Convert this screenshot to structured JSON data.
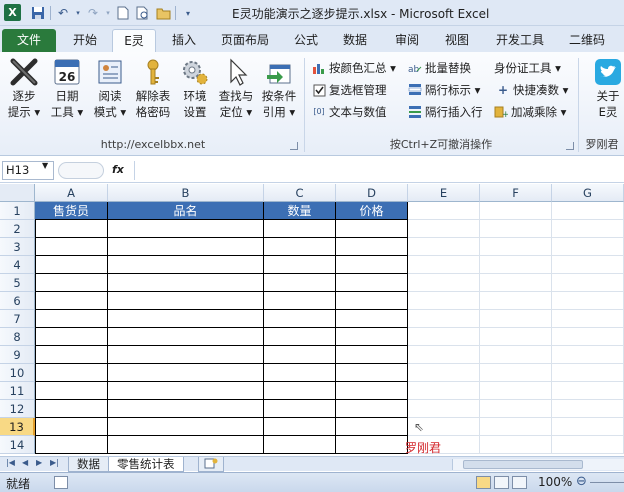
{
  "titlebar": {
    "app_icon": "X",
    "title": "E灵功能演示之逐步提示.xlsx - Microsoft Excel"
  },
  "tabs": [
    {
      "label": "文件",
      "key": "file"
    },
    {
      "label": "开始",
      "key": "home"
    },
    {
      "label": "E灵",
      "key": "eling"
    },
    {
      "label": "插入",
      "key": "insert"
    },
    {
      "label": "页面布局",
      "key": "page-layout"
    },
    {
      "label": "公式",
      "key": "formulas"
    },
    {
      "label": "数据",
      "key": "data"
    },
    {
      "label": "审阅",
      "key": "review"
    },
    {
      "label": "视图",
      "key": "view"
    },
    {
      "label": "开发工具",
      "key": "developer"
    },
    {
      "label": "二维码",
      "key": "qrcode"
    }
  ],
  "ribbon": {
    "group1": {
      "label": "http://excelbbx.net",
      "buttons": [
        {
          "l1": "逐步",
          "l2": "提示 ▾",
          "icon": "x-tool-icon"
        },
        {
          "l1": "日期",
          "l2": "工具 ▾",
          "icon": "calendar-icon",
          "day": "26"
        },
        {
          "l1": "阅读",
          "l2": "模式 ▾",
          "icon": "reading-mode-icon"
        },
        {
          "l1": "解除表",
          "l2": "格密码",
          "icon": "key-icon"
        },
        {
          "l1": "环境",
          "l2": "设置",
          "icon": "gears-icon"
        },
        {
          "l1": "查找与",
          "l2": "定位 ▾",
          "icon": "cursor-icon"
        },
        {
          "l1": "按条件",
          "l2": "引用 ▾",
          "icon": "reference-icon"
        }
      ]
    },
    "group2": {
      "label": "按Ctrl+Z可撤消操作",
      "items": [
        {
          "label": "按颜色汇总 ▾",
          "icon": "bar-chart-icon"
        },
        {
          "label": "批量替换",
          "icon": "replace-icon"
        },
        {
          "label": "身份证工具 ▾",
          "icon": ""
        },
        {
          "label": "复选框管理",
          "icon": "checkbox-icon"
        },
        {
          "label": "隔行标示 ▾",
          "icon": "alternate-rows-icon"
        },
        {
          "label": "快捷凑数 ▾",
          "icon": "plus-icon"
        },
        {
          "label": "文本与数值",
          "icon": "text-number-icon"
        },
        {
          "label": "隔行插入行",
          "icon": "insert-rows-icon"
        },
        {
          "label": "加减乘除 ▾",
          "icon": "arithmetic-icon"
        }
      ]
    },
    "group3": {
      "label": "罗刚君",
      "button": {
        "l1": "关于",
        "l2": "E灵",
        "icon": "twitter-bird-icon"
      }
    }
  },
  "formula_bar": {
    "name_box": "H13",
    "fx": "fx",
    "content": ""
  },
  "sheet": {
    "columns": [
      "A",
      "B",
      "C",
      "D",
      "E",
      "F",
      "G"
    ],
    "rows": [
      "1",
      "2",
      "3",
      "4",
      "5",
      "6",
      "7",
      "8",
      "9",
      "10",
      "11",
      "12",
      "13",
      "14"
    ],
    "selected_row": "13",
    "table_headers": [
      "售货员",
      "品名",
      "数量",
      "价格"
    ],
    "watermark": "罗刚君"
  },
  "sheet_tabs": [
    {
      "label": "数据",
      "active": false
    },
    {
      "label": "零售统计表",
      "active": true
    }
  ],
  "statusbar": {
    "status": "就绪",
    "zoom": "100%"
  },
  "colors": {
    "header_fill": "#3c6fb4",
    "file_tab": "#2a7a3c",
    "watermark": "#d3272c"
  }
}
